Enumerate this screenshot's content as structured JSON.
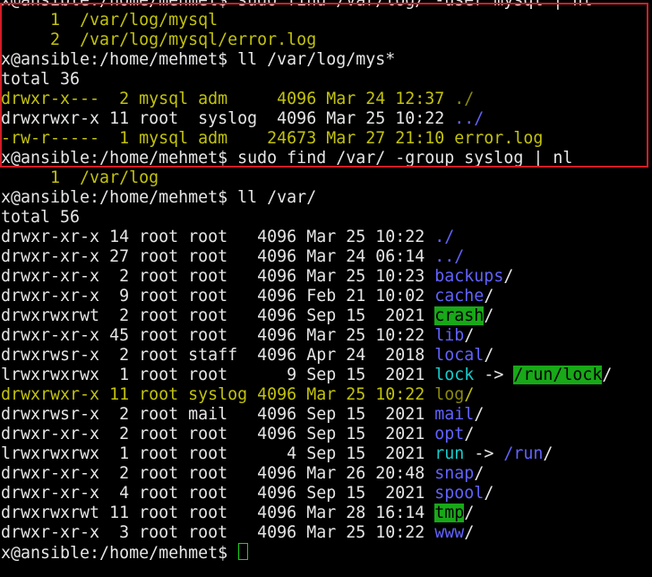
{
  "colors": {
    "background": "#000000",
    "text": "#e6e6e6",
    "yellow": "#c2c20e",
    "blue": "#6262ff",
    "cyan": "#15cccc",
    "highlight_bg": "#18a818",
    "annotation_box": "#d21d26"
  },
  "lines": [
    [
      {
        "t": "x@ansible:/home/mehmet$ sudo find /var/log/ -user mysql | nl",
        "c": "white"
      }
    ],
    [
      {
        "t": "     1  /var/log/mysql",
        "c": "yellow"
      }
    ],
    [
      {
        "t": "     2  /var/log/mysql/error.log",
        "c": "yellow"
      }
    ],
    [
      {
        "t": "x@ansible:/home/mehmet$ ll /var/log/mys*",
        "c": "white"
      }
    ],
    [
      {
        "t": "total 36",
        "c": "white"
      }
    ],
    [
      {
        "t": "drwxr-x---  2 mysql adm     4096 Mar 24 12:37 ",
        "c": "yellow"
      },
      {
        "t": "./",
        "c": "olive"
      }
    ],
    [
      {
        "t": "drwxrwxr-x 11 root  syslog  4096 Mar 25 10:22 ",
        "c": "white"
      },
      {
        "t": "../",
        "c": "blue"
      }
    ],
    [
      {
        "t": "-rw-r-----  1 mysql adm    24673 Mar 27 21:10 error.log",
        "c": "yellow"
      }
    ],
    [
      {
        "t": "x@ansible:/home/mehmet$ sudo find /var/ -group syslog | nl",
        "c": "white"
      }
    ],
    [
      {
        "t": "     1  /var/log",
        "c": "yellow"
      }
    ],
    [
      {
        "t": "x@ansible:/home/mehmet$ ll /var/",
        "c": "white"
      }
    ],
    [
      {
        "t": "total 56",
        "c": "white"
      }
    ],
    [
      {
        "t": "drwxr-xr-x 14 root root   4096 Mar 25 10:22 ",
        "c": "white"
      },
      {
        "t": "./",
        "c": "blue"
      }
    ],
    [
      {
        "t": "drwxr-xr-x 27 root root   4096 Mar 24 06:14 ",
        "c": "white"
      },
      {
        "t": "../",
        "c": "blue"
      }
    ],
    [
      {
        "t": "drwxr-xr-x  2 root root   4096 Mar 25 10:23 ",
        "c": "white"
      },
      {
        "t": "backups",
        "c": "blue"
      },
      {
        "t": "/",
        "c": "white"
      }
    ],
    [
      {
        "t": "drwxr-xr-x  9 root root   4096 Feb 21 10:02 ",
        "c": "white"
      },
      {
        "t": "cache",
        "c": "blue"
      },
      {
        "t": "/",
        "c": "white"
      }
    ],
    [
      {
        "t": "drwxrwxrwt  2 root root   4096 Sep 15  2021 ",
        "c": "white"
      },
      {
        "t": "crash",
        "c": "hl"
      },
      {
        "t": "/",
        "c": "white"
      }
    ],
    [
      {
        "t": "drwxr-xr-x 45 root root   4096 Mar 25 10:22 ",
        "c": "white"
      },
      {
        "t": "lib",
        "c": "blue"
      },
      {
        "t": "/",
        "c": "white"
      }
    ],
    [
      {
        "t": "drwxrwsr-x  2 root staff  4096 Apr 24  2018 ",
        "c": "white"
      },
      {
        "t": "local",
        "c": "blue"
      },
      {
        "t": "/",
        "c": "white"
      }
    ],
    [
      {
        "t": "lrwxrwxrwx  1 root root      9 Sep 15  2021 ",
        "c": "white"
      },
      {
        "t": "lock",
        "c": "cyan"
      },
      {
        "t": " -> ",
        "c": "white"
      },
      {
        "t": "/run/lock",
        "c": "hl"
      },
      {
        "t": "/",
        "c": "white"
      }
    ],
    [
      {
        "t": "drwxrwxr-x 11 root syslog 4096 Mar 25 10:22 ",
        "c": "yellow"
      },
      {
        "t": "log",
        "c": "olive"
      },
      {
        "t": "/",
        "c": "yellow"
      }
    ],
    [
      {
        "t": "drwxrwsr-x  2 root mail   4096 Sep 15  2021 ",
        "c": "white"
      },
      {
        "t": "mail",
        "c": "blue"
      },
      {
        "t": "/",
        "c": "white"
      }
    ],
    [
      {
        "t": "drwxr-xr-x  2 root root   4096 Sep 15  2021 ",
        "c": "white"
      },
      {
        "t": "opt",
        "c": "blue"
      },
      {
        "t": "/",
        "c": "white"
      }
    ],
    [
      {
        "t": "lrwxrwxrwx  1 root root      4 Sep 15  2021 ",
        "c": "white"
      },
      {
        "t": "run",
        "c": "cyan"
      },
      {
        "t": " -> ",
        "c": "white"
      },
      {
        "t": "/run",
        "c": "blue"
      },
      {
        "t": "/",
        "c": "white"
      }
    ],
    [
      {
        "t": "drwxr-xr-x  2 root root   4096 Mar 26 20:48 ",
        "c": "white"
      },
      {
        "t": "snap",
        "c": "blue"
      },
      {
        "t": "/",
        "c": "white"
      }
    ],
    [
      {
        "t": "drwxr-xr-x  4 root root   4096 Sep 15  2021 ",
        "c": "white"
      },
      {
        "t": "spool",
        "c": "blue"
      },
      {
        "t": "/",
        "c": "white"
      }
    ],
    [
      {
        "t": "drwxrwxrwt 11 root root   4096 Mar 28 16:14 ",
        "c": "white"
      },
      {
        "t": "tmp",
        "c": "hl"
      },
      {
        "t": "/",
        "c": "white"
      }
    ],
    [
      {
        "t": "drwxr-xr-x  3 root root   4096 Mar 25 10:22 ",
        "c": "white"
      },
      {
        "t": "www",
        "c": "blue"
      },
      {
        "t": "/",
        "c": "white"
      }
    ],
    [
      {
        "t": "x@ansible:/home/mehmet$ ",
        "c": "white"
      }
    ]
  ]
}
